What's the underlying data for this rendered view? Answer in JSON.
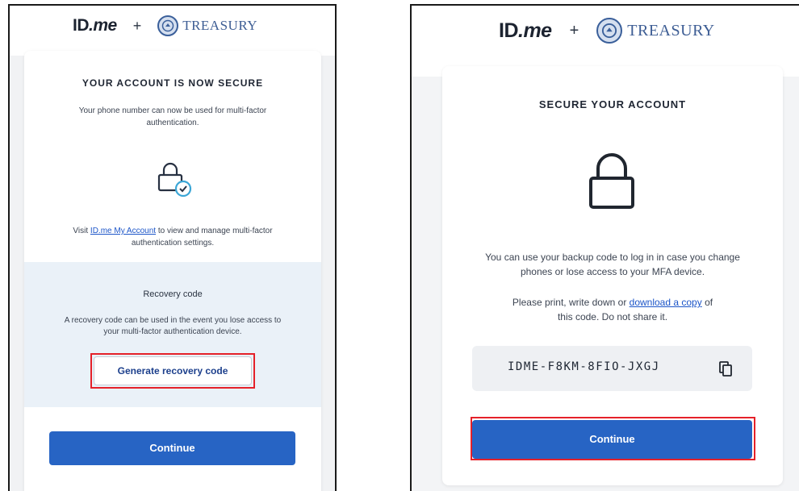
{
  "brand": {
    "idme_main": "ID",
    "idme_dot": ".me",
    "plus": "+",
    "treasury": "TREASURY"
  },
  "left": {
    "title": "YOUR ACCOUNT IS NOW SECURE",
    "subtitle": "Your phone number can now be used for multi-factor authentication.",
    "visit_prefix": "Visit ",
    "visit_link": "ID.me My Account",
    "visit_suffix": " to view and manage multi-factor authentication settings.",
    "recovery_title": "Recovery code",
    "recovery_body": "A recovery code can be used in the event you lose access to your multi-factor authentication device.",
    "generate_button": "Generate recovery code",
    "continue_button": "Continue"
  },
  "right": {
    "title": "SECURE YOUR ACCOUNT",
    "body1": "You can use your backup code to log in in case you change phones or lose access to your MFA device.",
    "body2_prefix": "Please print, write down or ",
    "body2_link": "download a copy",
    "body2_suffix": " of this code. Do not share it.",
    "code": "IDME-F8KM-8FIO-JXGJ",
    "continue_button": "Continue"
  },
  "colors": {
    "primary": "#2764c4",
    "link": "#1c55c8",
    "highlight": "#e52129",
    "recovery_bg": "#eaf1f8"
  },
  "icons": [
    "treasury-seal-icon",
    "lock-check-icon",
    "lock-icon",
    "copy-icon"
  ]
}
